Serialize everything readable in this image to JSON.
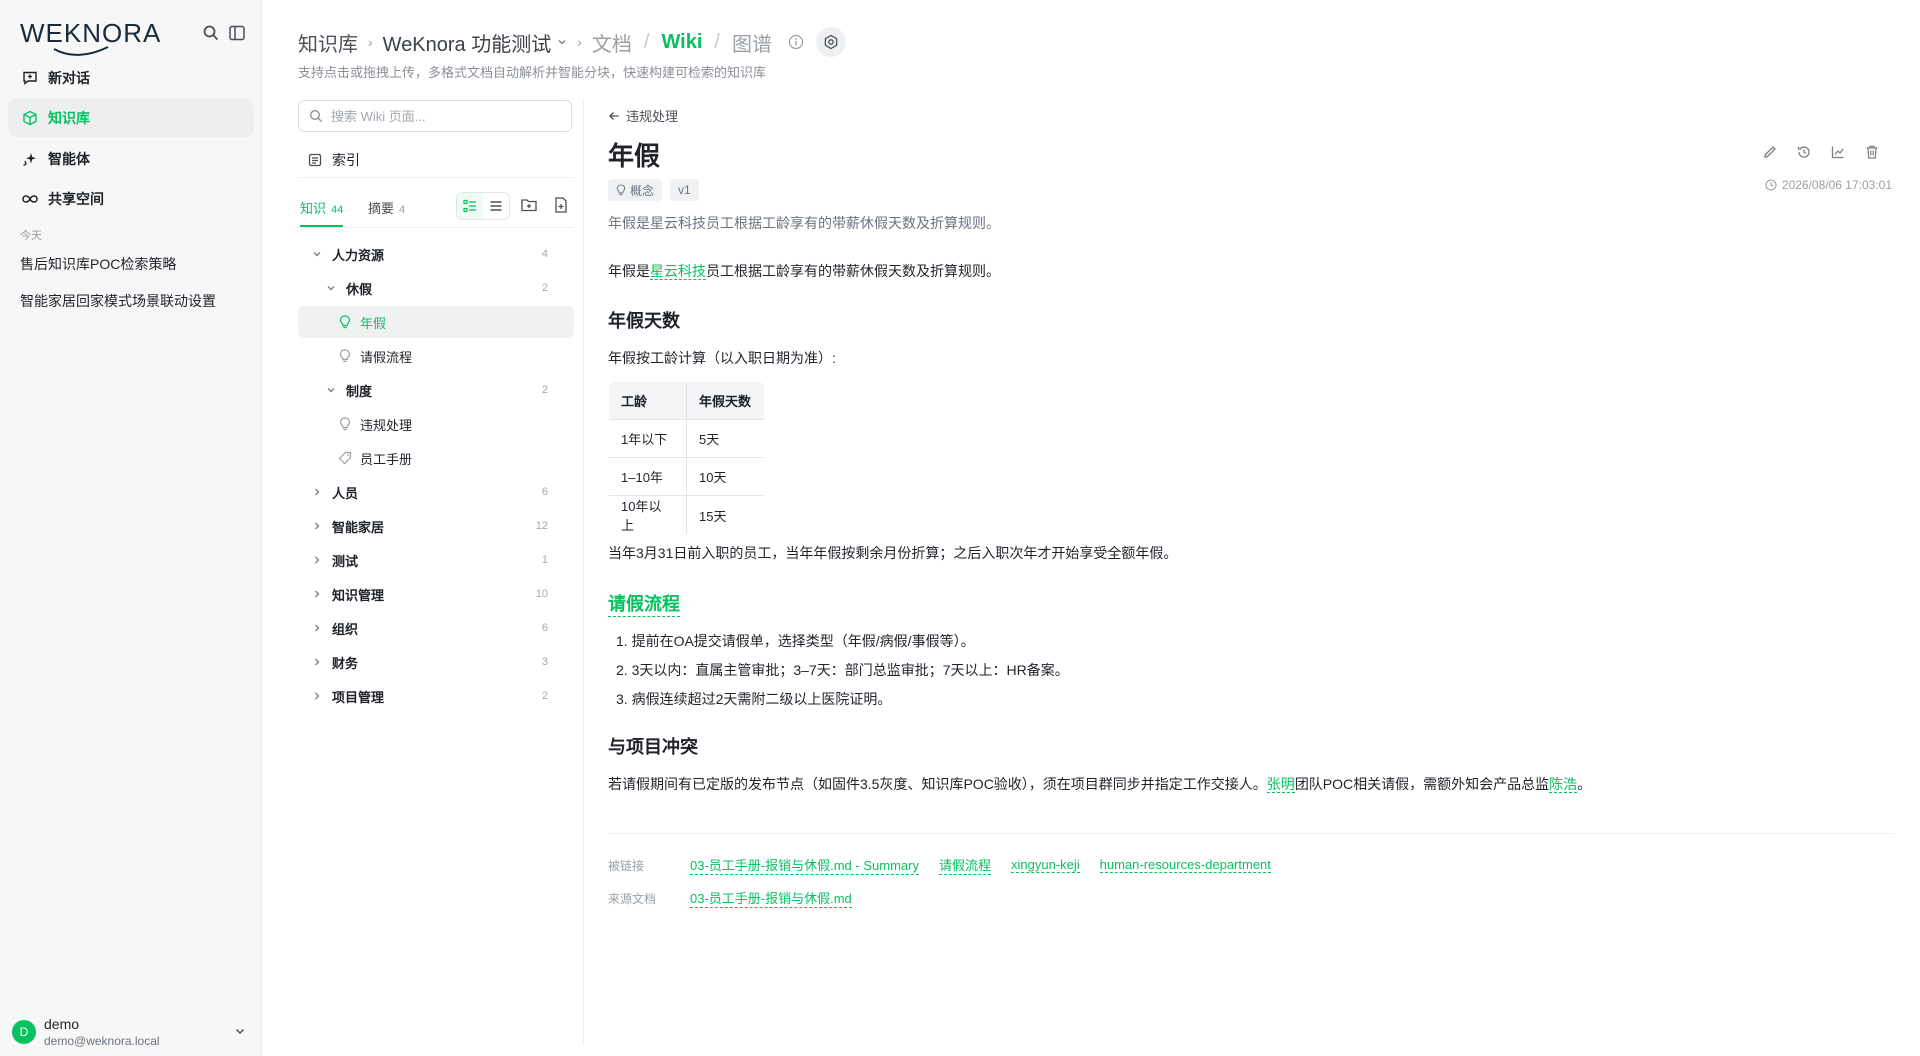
{
  "sidebar": {
    "logo": "WEKNORA",
    "nav": [
      {
        "label": "新对话",
        "icon": "chat-plus-icon"
      },
      {
        "label": "知识库",
        "icon": "cube-icon",
        "active": true
      },
      {
        "label": "智能体",
        "icon": "sparkle-icon"
      },
      {
        "label": "共享空间",
        "icon": "infinity-icon"
      }
    ],
    "section_today": "今天",
    "history": [
      "售后知识库POC检索策略",
      "智能家居回家模式场景联动设置"
    ],
    "user": {
      "initial": "D",
      "name": "demo",
      "email": "demo@weknora.local"
    }
  },
  "header": {
    "crumb_root": "知识库",
    "crumb_kb": "WeKnora 功能测试",
    "tabs": [
      "文档",
      "Wiki",
      "图谱"
    ],
    "active_tab": "Wiki",
    "subtitle": "支持点击或拖拽上传，多格式文档自动解析并智能分块，快速构建可检索的知识库"
  },
  "tree": {
    "search_placeholder": "搜索 Wiki 页面...",
    "index_label": "索引",
    "tab_knowledge": "知识",
    "tab_knowledge_count": "44",
    "tab_summary": "摘要",
    "tab_summary_count": "4",
    "rows": [
      {
        "label": "人力资源",
        "count": "4",
        "type": "folder",
        "expanded": true
      },
      {
        "label": "休假",
        "count": "2",
        "type": "folder",
        "expanded": true
      },
      {
        "label": "年假",
        "type": "concept",
        "selected": true
      },
      {
        "label": "请假流程",
        "type": "concept"
      },
      {
        "label": "制度",
        "count": "2",
        "type": "folder",
        "expanded": true
      },
      {
        "label": "违规处理",
        "type": "concept"
      },
      {
        "label": "员工手册",
        "type": "tag"
      },
      {
        "label": "人员",
        "count": "6",
        "type": "folder"
      },
      {
        "label": "智能家居",
        "count": "12",
        "type": "folder"
      },
      {
        "label": "测试",
        "count": "1",
        "type": "folder"
      },
      {
        "label": "知识管理",
        "count": "10",
        "type": "folder"
      },
      {
        "label": "组织",
        "count": "6",
        "type": "folder"
      },
      {
        "label": "财务",
        "count": "3",
        "type": "folder"
      },
      {
        "label": "项目管理",
        "count": "2",
        "type": "folder"
      }
    ]
  },
  "page": {
    "back_label": "违规处理",
    "title": "年假",
    "tag_type": "概念",
    "tag_version": "v1",
    "timestamp": "2026/08/06 17:03:01",
    "summary": "年假是星云科技员工根据工龄享有的带薪休假天数及折算规则。",
    "intro_prefix": "年假是",
    "intro_link": "星云科技",
    "intro_suffix": "员工根据工龄享有的带薪休假天数及折算规则。",
    "h_days": "年假天数",
    "days_desc": "年假按工龄计算（以入职日期为准）:",
    "table": {
      "headers": [
        "工龄",
        "年假天数"
      ],
      "rows": [
        [
          "1年以下",
          "5天"
        ],
        [
          "1–10年",
          "10天"
        ],
        [
          "10年以上",
          "15天"
        ]
      ]
    },
    "proration": "当年3月31日前入职的员工，当年年假按剩余月份折算；之后入职次年才开始享受全额年假。",
    "h_process": "请假流程",
    "steps": [
      "1. 提前在OA提交请假单，选择类型（年假/病假/事假等）。",
      "2. 3天以内：直属主管审批；3–7天：部门总监审批；7天以上：HR备案。",
      "3. 病假连续超过2天需附二级以上医院证明。"
    ],
    "h_conflict": "与项目冲突",
    "conflict_prefix": "若请假期间有已定版的发布节点（如固件3.5灰度、知识库POC验收），须在项目群同步并指定工作交接人。",
    "conflict_link1": "张明",
    "conflict_mid": "团队POC相关请假，需额外知会产品总监",
    "conflict_link2": "陈浩",
    "conflict_end": "。",
    "backlinks_label": "被链接",
    "backlinks": [
      "03-员工手册-报销与休假.md - Summary",
      "请假流程",
      "xingyun-keji",
      "human-resources-department"
    ],
    "sources_label": "来源文档",
    "sources": [
      "03-员工手册-报销与休假.md"
    ]
  },
  "colors": {
    "accent": "#07c160",
    "text": "#1f2329",
    "muted": "#9aa0a6"
  }
}
